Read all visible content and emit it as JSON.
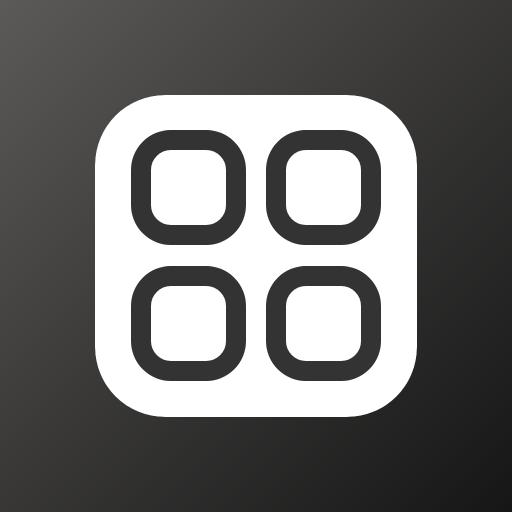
{
  "app_icon": {
    "icon": "four-rounded-squares-grid-icon",
    "tiles": [
      "grid-tile-icon",
      "grid-tile-icon",
      "grid-tile-icon",
      "grid-tile-icon"
    ]
  },
  "colors": {
    "background_top_left": "#5c5a59",
    "background_bottom_right": "#161616",
    "tile_background": "#ffffff",
    "glyph_stroke": "#333333"
  }
}
